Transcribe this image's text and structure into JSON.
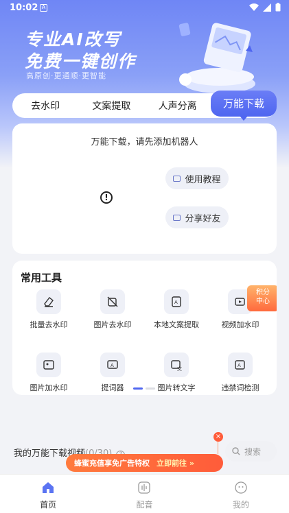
{
  "status_bar": {
    "time": "10:02"
  },
  "banner": {
    "title_line1": "专业AI改写",
    "title_line2": "免费一键创作",
    "subtitle": "高原创·更通顺·更智能"
  },
  "tabs": [
    "去水印",
    "文案提取",
    "人声分离",
    "万能下载"
  ],
  "download_card": {
    "message": "万能下载，请先添加机器人",
    "tutorial_label": "使用教程",
    "share_label": "分享好友"
  },
  "tools": {
    "title": "常用工具",
    "badge": [
      "积分",
      "中心"
    ],
    "row1": [
      "批量去水印",
      "图片去水印",
      "本地文案提取",
      "视频加水印"
    ],
    "row2": [
      "图片加水印",
      "提词器",
      "图片转文字",
      "违禁词检测"
    ]
  },
  "downloads": {
    "label": "我的万能下载视频",
    "count": "(0/30)",
    "search_placeholder": "搜索"
  },
  "promo": {
    "text": "蜂蜜充值享免广告特权",
    "action": "立即前往 »",
    "close": "×"
  },
  "bottom_nav": [
    "首页",
    "配音",
    "我的"
  ],
  "colors": {
    "accent": "#4f66f0",
    "promo": "#ff5c3a"
  }
}
